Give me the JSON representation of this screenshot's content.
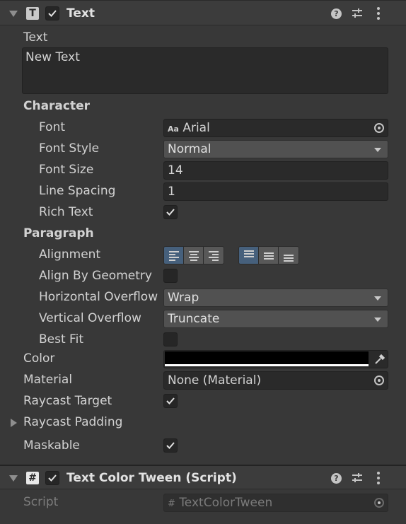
{
  "text_component": {
    "title": "Text",
    "icon": "T",
    "enabled": true,
    "text_label": "Text",
    "text_value": "New Text",
    "character_label": "Character",
    "font_label": "Font",
    "font_prefix": "Aa",
    "font_value": "Arial",
    "font_style_label": "Font Style",
    "font_style_value": "Normal",
    "font_size_label": "Font Size",
    "font_size_value": "14",
    "line_spacing_label": "Line Spacing",
    "line_spacing_value": "1",
    "rich_text_label": "Rich Text",
    "rich_text_checked": true,
    "paragraph_label": "Paragraph",
    "alignment_label": "Alignment",
    "horizontal_alignment": "left",
    "vertical_alignment": "top",
    "align_by_geometry_label": "Align By Geometry",
    "align_by_geometry_checked": false,
    "horizontal_overflow_label": "Horizontal Overflow",
    "horizontal_overflow_value": "Wrap",
    "vertical_overflow_label": "Vertical Overflow",
    "vertical_overflow_value": "Truncate",
    "best_fit_label": "Best Fit",
    "best_fit_checked": false,
    "color_label": "Color",
    "color_value": "#000000",
    "material_label": "Material",
    "material_value": "None (Material)",
    "raycast_target_label": "Raycast Target",
    "raycast_target_checked": true,
    "raycast_padding_label": "Raycast Padding",
    "maskable_label": "Maskable",
    "maskable_checked": true
  },
  "tween_component": {
    "title": "Text Color Tween (Script)",
    "icon": "#",
    "enabled": true,
    "script_label": "Script",
    "script_prefix": "#",
    "script_value": "TextColorTween"
  },
  "colors": {
    "panel_bg": "#383838",
    "field_bg": "#2a2a2a",
    "popup_bg": "#515151",
    "active_button": "#46607c"
  }
}
